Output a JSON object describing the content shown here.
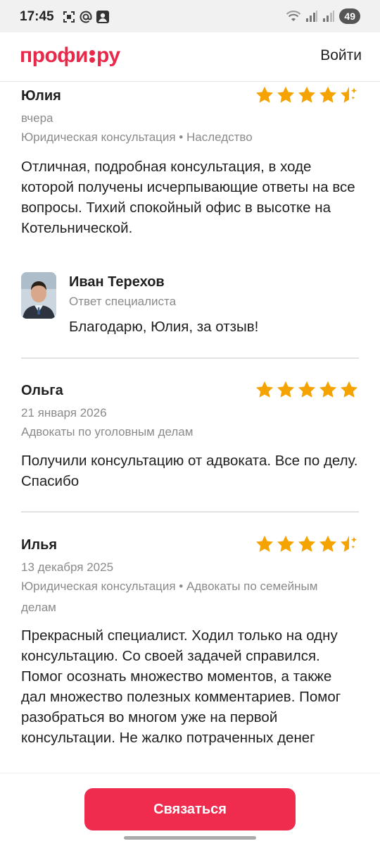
{
  "status_bar": {
    "time": "17:45",
    "battery": "49",
    "left_icons": [
      "screenshot-icon",
      "at-icon",
      "account-icon"
    ],
    "right_icons": [
      "wifi-icon",
      "signal-icon",
      "signal-icon"
    ]
  },
  "header": {
    "logo": "профи.ру",
    "login_label": "Войти"
  },
  "colors": {
    "brand": "#e8294a",
    "button": "#ef2b4e",
    "star": "#f5a300",
    "muted_text": "#8a8a8a"
  },
  "reviews": [
    {
      "name": "Юлия",
      "date": "вчера",
      "category": "Юридическая консультация • Наследство",
      "text": "Отличная, подробная консультация, в ходе которой получены исчерпывающие ответы на все вопросы. Тихий спокойный офис в высотке на Котельнической.",
      "rating": 4.5
    },
    {
      "name": "Ольга",
      "date": "21 января 2026",
      "category": "Адвокаты по уголовным делам",
      "text": "Получили консультацию от адвоката. Все по делу. Спасибо",
      "rating": 5
    },
    {
      "name": "Илья",
      "date": "13 декабря 2025",
      "category": "Юридическая консультация • Адвокаты по семейным делам",
      "text": "Прекрасный специалист. Ходил только на одну консультацию. Со своей задачей справился. Помог осознать множество моментов, а также дал множество полезных комментариев. Помог разобраться во многом уже на первой консультации. Не жалко потраченных денег",
      "rating": 4.5
    }
  ],
  "reply": {
    "name": "Иван Терехов",
    "role": "Ответ специалиста",
    "text": "Благодарю, Юлия, за отзыв!"
  },
  "cta": {
    "label": "Связаться"
  }
}
